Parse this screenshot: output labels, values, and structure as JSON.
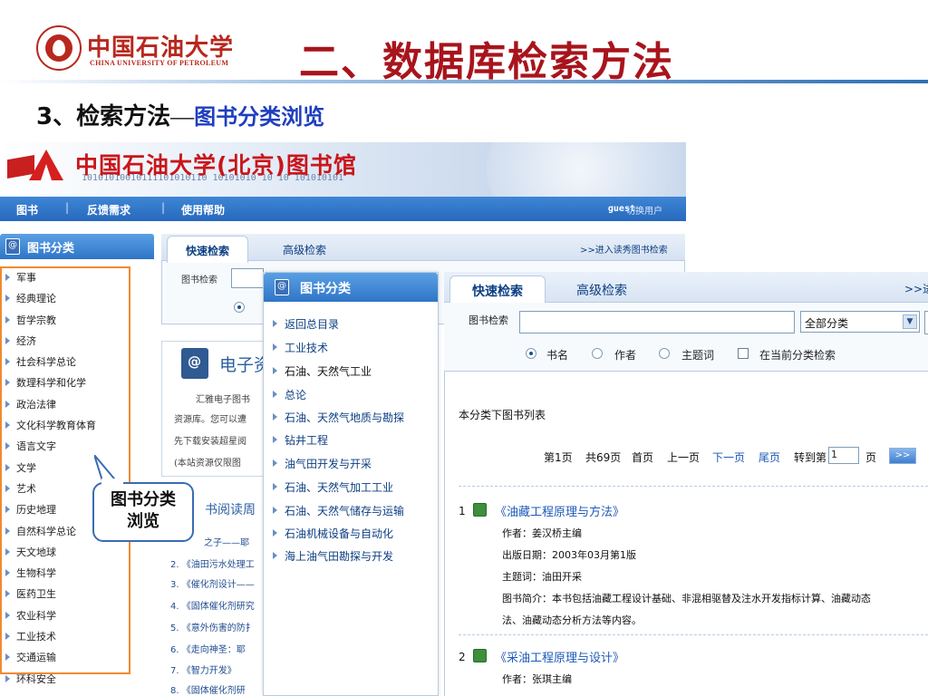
{
  "slide": {
    "logo_cn": "中国石油大学",
    "logo_en": "CHINA UNIVERSITY OF PETROLEUM",
    "title": "二、数据库检索方法",
    "heading_main": "3、检索方法",
    "heading_dash": "—",
    "heading_link": "图书分类浏览"
  },
  "library": {
    "title": "中国石油大学(北京)图书馆",
    "banner_binary": "10101010010111101010110   10101010   10 10 101010101",
    "nav": [
      "图书",
      "反馈需求",
      "使用帮助"
    ],
    "nav_sep": "|",
    "guest": "guest",
    "switch_user": "切换用户",
    "category_panel_title": "图书分类",
    "categories": [
      "军事",
      "经典理论",
      "哲学宗教",
      "经济",
      "社会科学总论",
      "数理科学和化学",
      "政治法律",
      "文化科学教育体育",
      "语言文字",
      "文学",
      "艺术",
      "历史地理",
      "自然科学总论",
      "天文地球",
      "生物科学",
      "医药卫生",
      "农业科学",
      "工业技术",
      "交通运输",
      "环科安全"
    ],
    "tab_quick": "快速检索",
    "tab_advanced": "高级检索",
    "reader_link": ">>进入读秀图书检索",
    "search_label": "图书检索",
    "eres_title": "电子资",
    "eres_lines": [
      "汇雅电子图书",
      "资源库。您可以遭",
      "先下载安装超星阅",
      "(本站资源仅限图"
    ],
    "reading_title": "书阅读周",
    "reading_items": [
      "之子——耶",
      "2. 《油田污水处理工",
      "3. 《催化剂设计——",
      "4. 《固体催化剂研究",
      "5. 《意外伤害的防扌",
      "6. 《走向神圣：耶",
      "7. 《智力开发》",
      "8. 《固体催化剂研"
    ]
  },
  "category_overlay": {
    "title": "图书分类",
    "items": [
      "返回总目录",
      "工业技术",
      "石油、天然气工业",
      "总论",
      "石油、天然气地质与勘探",
      "钻井工程",
      "油气田开发与开采",
      "石油、天然气加工工业",
      "石油、天然气储存与运输",
      "石油机械设备与自动化",
      "海上油气田勘探与开发"
    ]
  },
  "search_overlay": {
    "tab_quick": "快速检索",
    "tab_advanced": "高级检索",
    "more_link": ">>进",
    "search_label": "图书检索",
    "select_value": "全部分类",
    "options": [
      "书名",
      "作者",
      "主题词"
    ],
    "checkbox_label": "在当前分类检索",
    "list_title": "本分类下图书列表",
    "pager": {
      "page": "第1页",
      "total": "共69页",
      "first": "首页",
      "prev": "上一页",
      "next": "下一页",
      "last": "尾页",
      "goto": "转到第",
      "goto_value": "1",
      "page_unit": "页",
      "go": ">>"
    },
    "results": [
      {
        "num": "1",
        "title": "《油藏工程原理与方法》",
        "author": "作者：姜汉桥主编",
        "date": "出版日期：2003年03月第1版",
        "subject": "主题词：油田开采",
        "summary_1": "图书简介：本书包括油藏工程设计基础、非混相驱替及注水开发指标计算、油藏动态",
        "summary_2": "法、油藏动态分析方法等内容。"
      },
      {
        "num": "2",
        "title": "《采油工程原理与设计》",
        "author": "作者：张琪主编"
      }
    ]
  },
  "callout": {
    "line1": "图书分类",
    "line2": "浏览"
  },
  "colors": {
    "brand_red": "#a8141c",
    "link_blue": "#1f3ebf",
    "nav_blue": "#2769bd",
    "highlight_orange": "#f08a30"
  }
}
